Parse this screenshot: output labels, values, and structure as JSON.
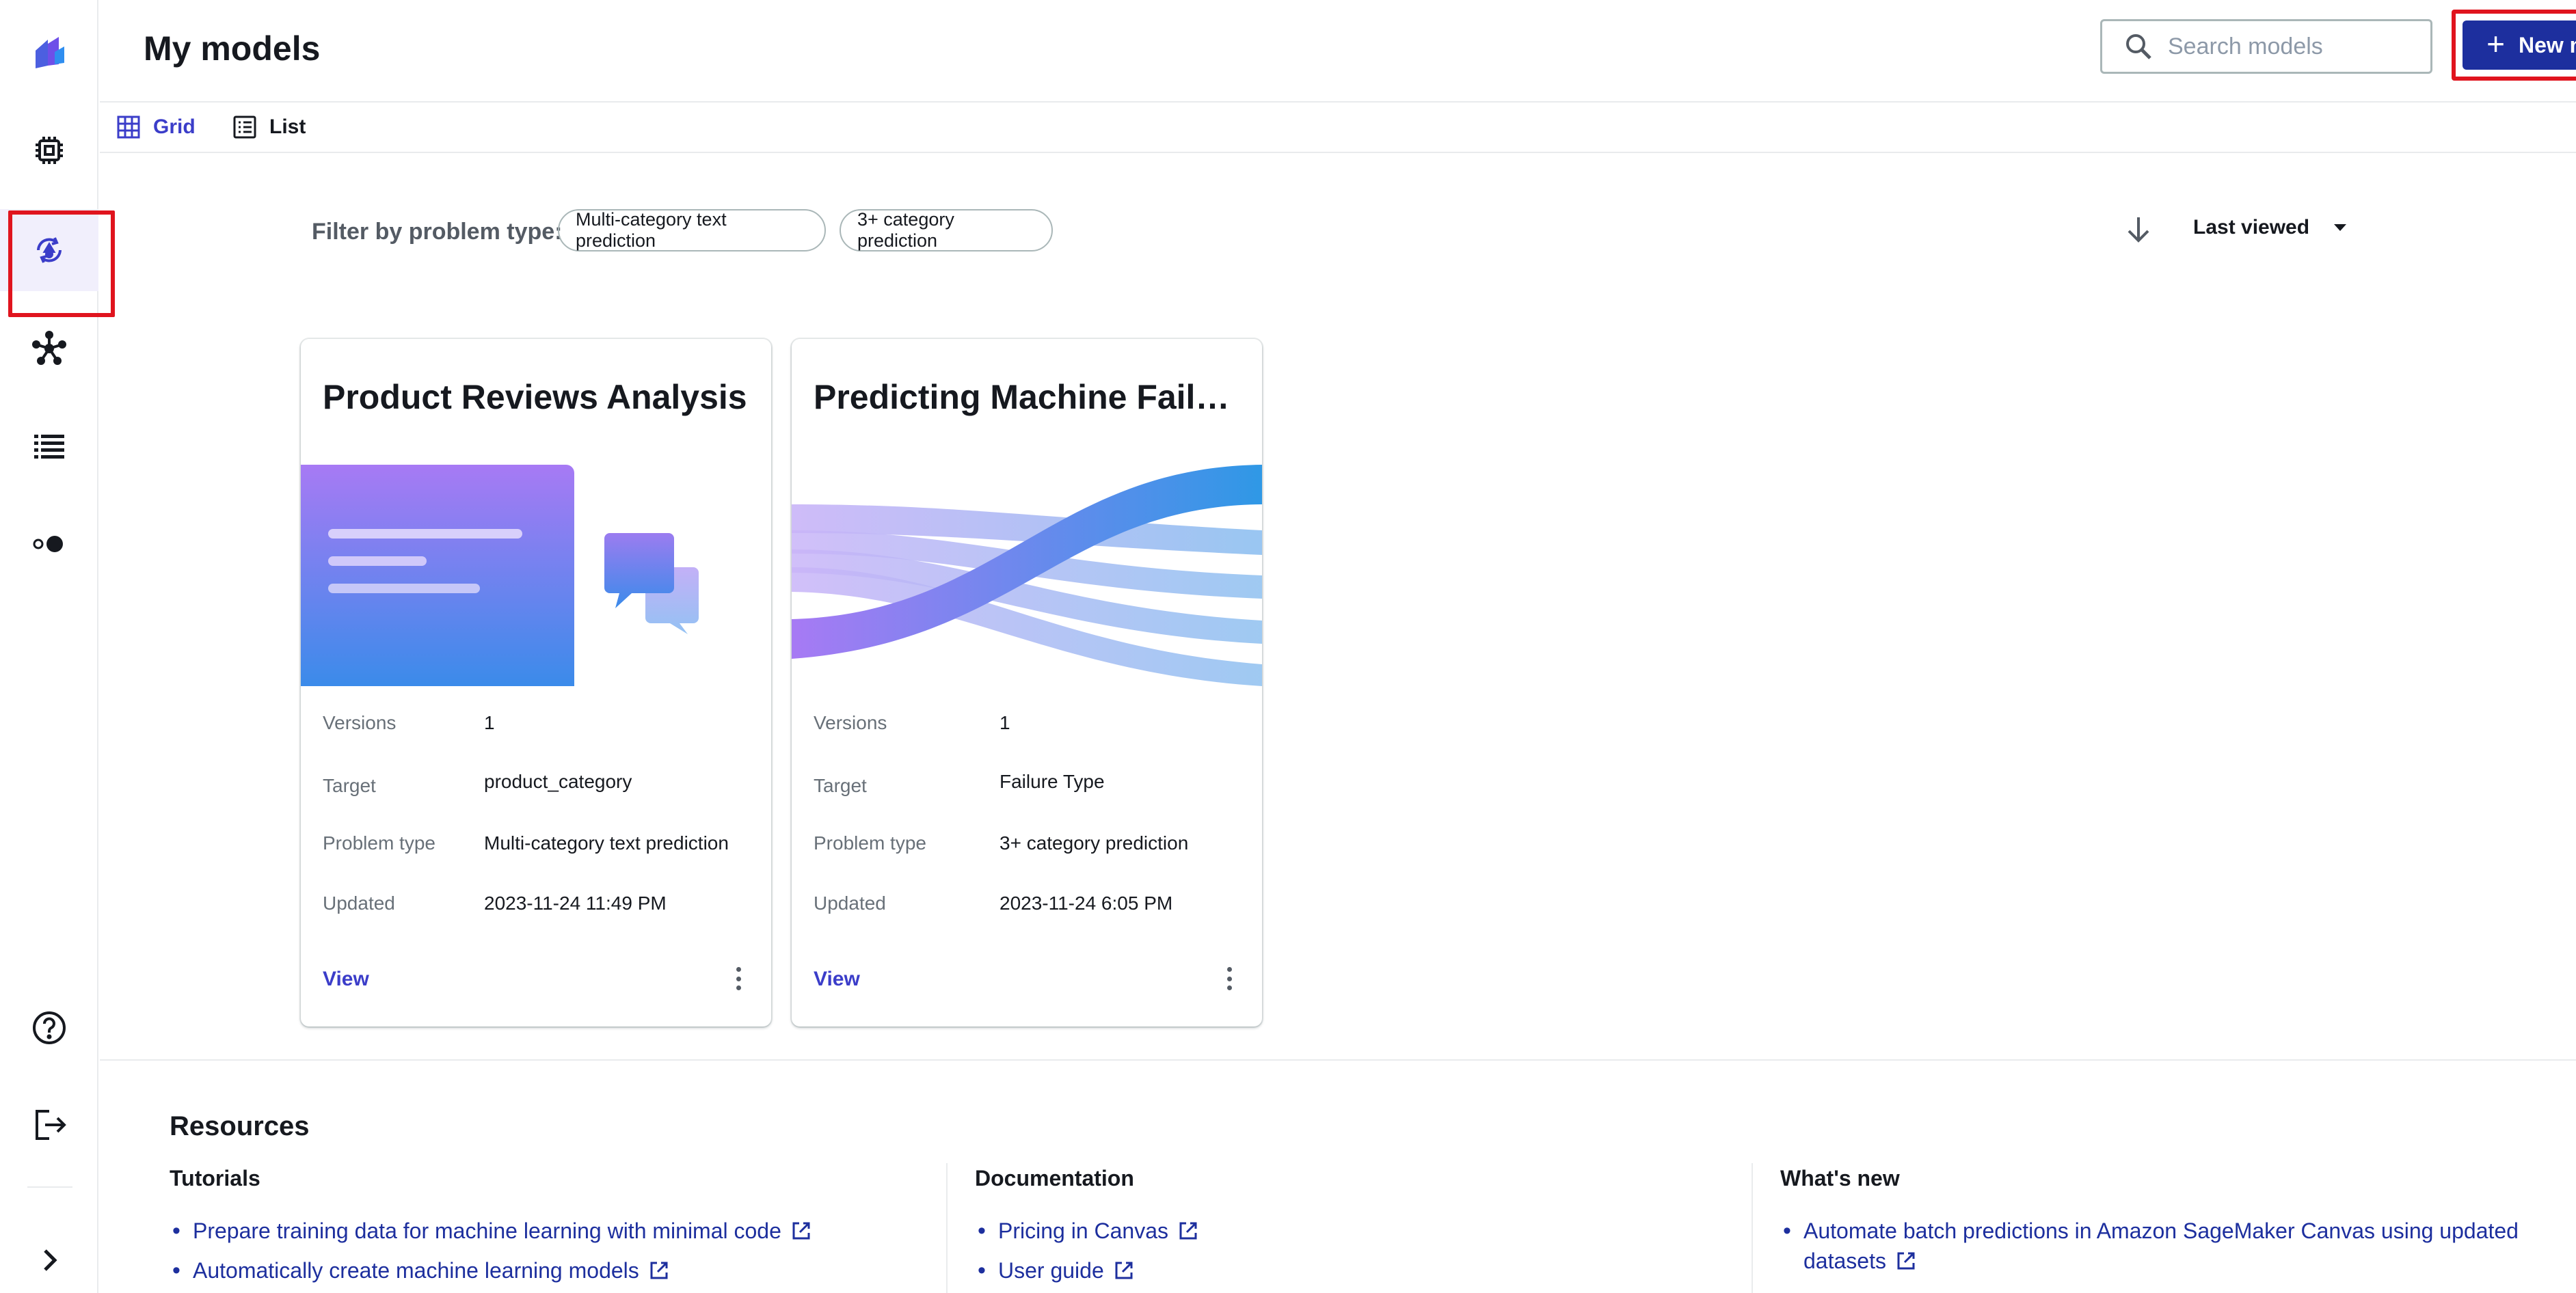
{
  "header": {
    "title": "My models",
    "search_placeholder": "Search models",
    "new_model_label": "New model"
  },
  "view_tabs": {
    "grid": "Grid",
    "list": "List"
  },
  "filter": {
    "label": "Filter by problem type:",
    "chips": [
      "Multi-category text prediction",
      "3+ category prediction"
    ]
  },
  "sort": {
    "selected": "Last viewed"
  },
  "cards": [
    {
      "title": "Product Reviews Analysis",
      "meta": [
        {
          "key": "Versions",
          "value": "1"
        },
        {
          "key": "Target",
          "value": "product_category"
        },
        {
          "key": "Problem type",
          "value": "Multi-category text prediction"
        },
        {
          "key": "Updated",
          "value": "2023-11-24 11:49 PM"
        }
      ],
      "view_label": "View"
    },
    {
      "title": "Predicting Machine Failu...",
      "meta": [
        {
          "key": "Versions",
          "value": "1"
        },
        {
          "key": "Target",
          "value": "Failure Type"
        },
        {
          "key": "Problem type",
          "value": "3+ category prediction"
        },
        {
          "key": "Updated",
          "value": "2023-11-24 6:05 PM"
        }
      ],
      "view_label": "View"
    }
  ],
  "resources": {
    "title": "Resources",
    "tutorials": {
      "heading": "Tutorials",
      "links": [
        "Prepare training data for machine learning with minimal code",
        "Automatically create machine learning models"
      ]
    },
    "documentation": {
      "heading": "Documentation",
      "links": [
        "Pricing in Canvas",
        "User guide"
      ]
    },
    "whats_new": {
      "heading": "What's new",
      "links": [
        "Automate batch predictions in Amazon SageMaker Canvas using updated datasets"
      ]
    }
  },
  "rail_icons": [
    "canvas-logo-icon",
    "chip-icon",
    "my-models-icon",
    "ml-ops-icon",
    "datasets-list-icon",
    "toggle-icon",
    "help-icon",
    "logout-icon",
    "expand-chevron-icon"
  ],
  "colors": {
    "accent": "#3b3dc9",
    "primary_button": "#1d2f9e",
    "highlight": "#e0141e"
  }
}
